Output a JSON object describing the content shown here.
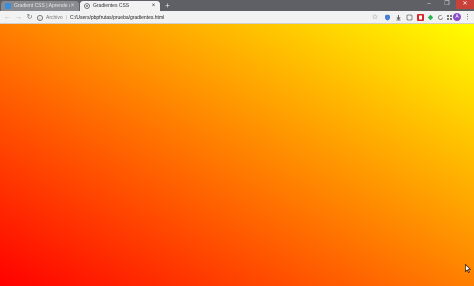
{
  "tabs": [
    {
      "title": "Gradient CSS | Aprende a crear degradados con CSS3",
      "active": false
    },
    {
      "title": "Gradientes CSS",
      "active": true
    }
  ],
  "toolbar": {
    "url_scheme": "Archivo",
    "url": "C:/Users/pbpfrutas/prueba/gradientes.html"
  },
  "window_controls": {
    "minimize": "–",
    "maximize": "❐",
    "close": "✕"
  },
  "extensions": [
    {
      "name": "shield-extension",
      "color": "#4a7fd4"
    },
    {
      "name": "download-extension",
      "color": "#555555"
    },
    {
      "name": "pocket-extension",
      "color": "#6a6a6a"
    },
    {
      "name": "pdf-extension",
      "color": "#d4262c"
    },
    {
      "name": "feedly-extension",
      "color": "#2bb24c"
    },
    {
      "name": "refresh-extension",
      "color": "#777777"
    },
    {
      "name": "cast-extension",
      "color": "#777777"
    },
    {
      "name": "grid-extension",
      "color": "#777777"
    }
  ],
  "colors": {
    "gradient_start": "#ff0000",
    "gradient_end": "#ffff00"
  }
}
